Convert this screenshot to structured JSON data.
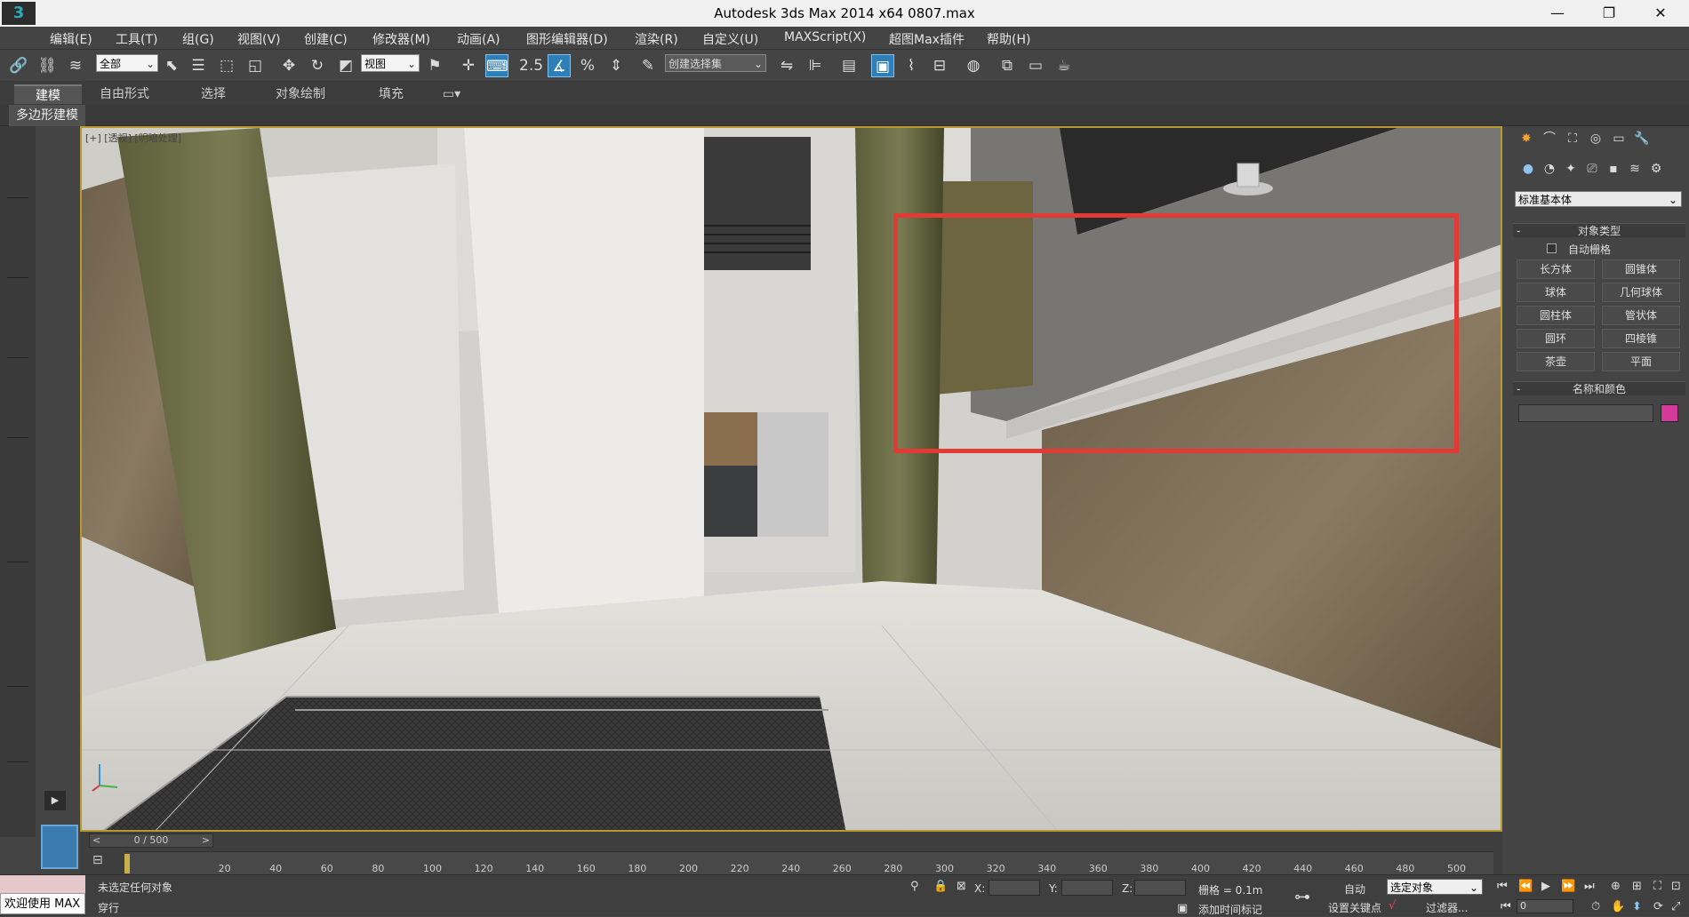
{
  "app": {
    "title": "Autodesk 3ds Max  2014 x64      0807.max",
    "logo_text": "3",
    "window_controls": [
      "—",
      "❐",
      "✕"
    ]
  },
  "menu": [
    "编辑(E)",
    "工具(T)",
    "组(G)",
    "视图(V)",
    "创建(C)",
    "修改器(M)",
    "动画(A)",
    "图形编辑器(D)",
    "渲染(R)",
    "自定义(U)",
    "MAXScript(X)",
    "超图Max插件",
    "帮助(H)"
  ],
  "toolbar": {
    "selection_filter": "全部",
    "reference_coord": "视图",
    "named_selection": "创建选择集",
    "snap_label": "2.5"
  },
  "ribbon": {
    "tabs": [
      "建模",
      "自由形式",
      "选择",
      "对象绘制",
      "填充"
    ],
    "active_tab": "建模",
    "panel_label": "多边形建模"
  },
  "viewport": {
    "label": "[+] [透视] [明暗处理]"
  },
  "command_panel": {
    "category": "标准基本体",
    "object_type_title": "对象类型",
    "autogrid_label": "自动栅格",
    "buttons": [
      "长方体",
      "圆锥体",
      "球体",
      "几何球体",
      "圆柱体",
      "管状体",
      "圆环",
      "四棱锥",
      "茶壶",
      "平面"
    ],
    "name_color_title": "名称和颜色",
    "object_color": "#d43a9b"
  },
  "timeline": {
    "slider_text": "0 / 500",
    "ruler_labels": [
      "20",
      "40",
      "60",
      "80",
      "100",
      "120",
      "140",
      "160",
      "180",
      "200",
      "220",
      "240",
      "260",
      "280",
      "300",
      "320",
      "340",
      "360",
      "380",
      "400",
      "420",
      "440",
      "460",
      "480",
      "500"
    ]
  },
  "status": {
    "welcome": "欢迎使用 MAX",
    "selection_info": "未选定任何对象",
    "prompt": "穿行",
    "x_label": "X:",
    "y_label": "Y:",
    "z_label": "Z:",
    "grid_info": "栅格 = 0.1m",
    "add_time_tag": "添加时间标记",
    "auto_key": "自动",
    "key_mode": "选定对象",
    "set_key": "设置关键点",
    "key_filters": "过滤器...",
    "frame_value": "0"
  }
}
